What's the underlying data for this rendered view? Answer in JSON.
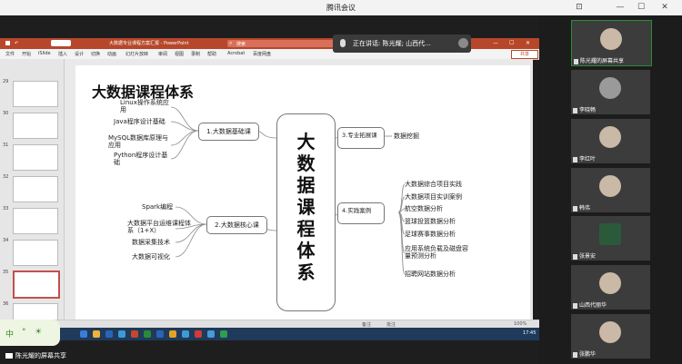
{
  "window": {
    "title": "腾讯会议"
  },
  "ppt": {
    "doc_title": "大数据专业课程方案汇报 - PowerPoint",
    "search_placeholder": "搜索",
    "ribbon_tabs": [
      "文件",
      "开始",
      "iSlide",
      "插入",
      "设计",
      "切换",
      "动画",
      "幻灯片放映",
      "审阅",
      "视图",
      "录制",
      "帮助",
      "Acrobat",
      "百度网盘"
    ],
    "share_label": "共享",
    "speaking": "正在讲话: 陈光耀; 山西代...",
    "thumb_numbers": [
      "29",
      "30",
      "31",
      "32",
      "33",
      "34",
      "35",
      "36"
    ],
    "status": {
      "notes": "备注",
      "comments": "批注",
      "zoom": "100%"
    },
    "clock": "17:45"
  },
  "slide": {
    "title": "大数据课程体系",
    "center": "大数据课程体系",
    "branch1": {
      "label": "1.大数据基础课",
      "items": [
        "Linux操作系统应用",
        "Java程序设计基础",
        "MySQL数据库原理与应用",
        "Python程序设计基础"
      ]
    },
    "branch2": {
      "label": "2.大数据核心课",
      "items": [
        "Spark编程",
        "大数据平台运维课程体系（1+X）",
        "数据采集技术",
        "大数据可视化"
      ]
    },
    "branch3": {
      "label": "3.专业拓展课",
      "items": [
        "数据挖掘"
      ]
    },
    "branch4": {
      "label": "4.实践案例",
      "items": [
        "大数据综合项目实践",
        "大数据项目实训案例",
        "航空数据分析",
        "篮球投篮数据分析",
        "足球赛事数据分析",
        "应用系统负载及磁盘容量预测分析",
        "招聘网站数据分析"
      ]
    }
  },
  "bottom": {
    "screen_share_label": "陈光耀的屏幕共享",
    "ime": [
      "中",
      "°",
      "☀"
    ]
  },
  "participants": [
    {
      "name": "陈光耀的屏幕共享"
    },
    {
      "name": "李晓畅"
    },
    {
      "name": "李红叶"
    },
    {
      "name": "韩伟"
    },
    {
      "name": "张景安"
    },
    {
      "name": "山西代丽华"
    },
    {
      "name": "张鹏华"
    }
  ]
}
